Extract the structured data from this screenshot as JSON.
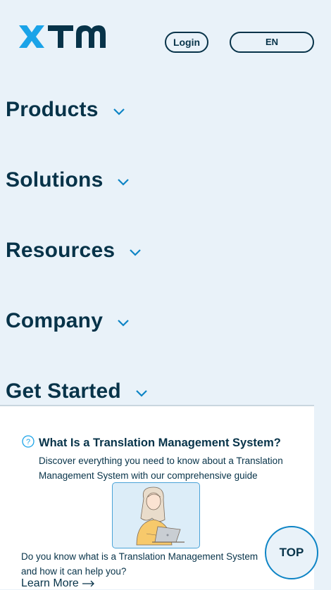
{
  "header": {
    "logo_text": "XTM",
    "login_label": "Login",
    "language_label": "EN"
  },
  "nav": {
    "items": [
      {
        "label": "Products"
      },
      {
        "label": "Solutions"
      },
      {
        "label": "Resources"
      },
      {
        "label": "Company"
      },
      {
        "label": "Get Started"
      }
    ]
  },
  "card": {
    "title": "What Is a Translation Management System?",
    "description": "Discover everything you need to know about a Translation Management System with our comprehensive guide",
    "question": "Do you know what is a Translation Management System and how it can help you?",
    "learn_more": "Learn More",
    "icon": "question-circle-icon"
  },
  "top_button": {
    "label": "TOP"
  },
  "colors": {
    "brand_dark": "#073349",
    "accent": "#0d84c5",
    "logo_blue": "#1aa3e8",
    "background": "#e9f2f9"
  }
}
